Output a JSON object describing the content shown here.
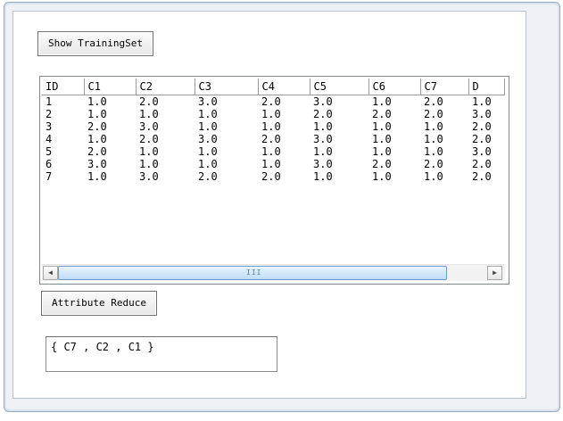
{
  "buttons": {
    "show_training_set": "Show TrainingSet",
    "attribute_reduce": "Attribute Reduce"
  },
  "table": {
    "columns": [
      "ID",
      "C1",
      "C2",
      "C3",
      "C4",
      "C5",
      "C6",
      "C7",
      "D"
    ],
    "rows": [
      [
        "1",
        "1.0",
        "2.0",
        "3.0",
        "2.0",
        "3.0",
        "1.0",
        "2.0",
        "1.0"
      ],
      [
        "2",
        "1.0",
        "1.0",
        "1.0",
        "1.0",
        "2.0",
        "2.0",
        "2.0",
        "3.0"
      ],
      [
        "3",
        "2.0",
        "3.0",
        "1.0",
        "1.0",
        "1.0",
        "1.0",
        "1.0",
        "2.0"
      ],
      [
        "4",
        "1.0",
        "2.0",
        "3.0",
        "2.0",
        "3.0",
        "1.0",
        "1.0",
        "2.0"
      ],
      [
        "5",
        "2.0",
        "1.0",
        "1.0",
        "1.0",
        "1.0",
        "1.0",
        "1.0",
        "3.0"
      ],
      [
        "6",
        "3.0",
        "1.0",
        "1.0",
        "1.0",
        "3.0",
        "2.0",
        "2.0",
        "2.0"
      ],
      [
        "7",
        "1.0",
        "3.0",
        "2.0",
        "2.0",
        "1.0",
        "1.0",
        "1.0",
        "2.0"
      ]
    ]
  },
  "scrollbar": {
    "left_arrow": "◀",
    "right_arrow": "▶",
    "grip": "III"
  },
  "result": {
    "text": "{ C7 , C2 , C1 }"
  }
}
